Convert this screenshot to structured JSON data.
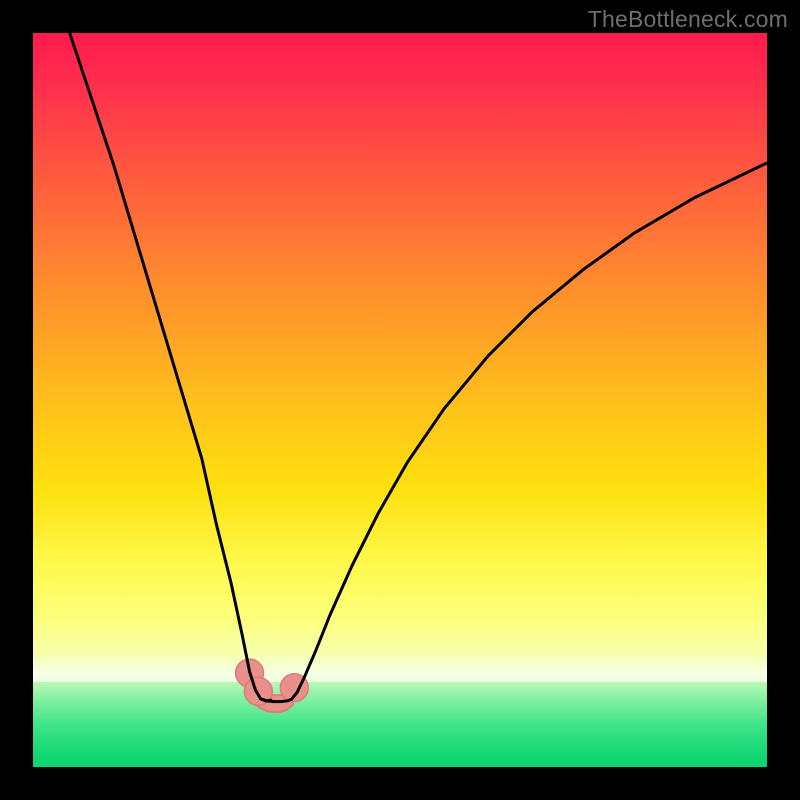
{
  "watermark": "TheBottleneck.com",
  "chart_data": {
    "type": "line",
    "title": "",
    "xlabel": "",
    "ylabel": "",
    "xlim": [
      0,
      100
    ],
    "ylim": [
      0,
      100
    ],
    "gradient_bands": [
      {
        "name": "red-to-yellow",
        "from_y_pct": 100,
        "to_y_pct": 12,
        "colors": [
          "#ff1a4d",
          "#ffb81e",
          "#fff94d"
        ]
      },
      {
        "name": "pale-transition",
        "from_y_pct": 12,
        "to_y_pct": 11,
        "colors": [
          "#f9ffcc",
          "#eefde4"
        ]
      },
      {
        "name": "green",
        "from_y_pct": 11,
        "to_y_pct": 0,
        "colors": [
          "#b9f9b6",
          "#0cd571"
        ]
      }
    ],
    "series": [
      {
        "name": "left_branch",
        "stroke": "#000000",
        "x": [
          5,
          8,
          11,
          14,
          17,
          20,
          23,
          25,
          27,
          28.5,
          29.5,
          30.3,
          31,
          31.7,
          32.4
        ],
        "y": [
          100,
          91,
          82,
          72,
          62,
          52,
          42,
          33,
          25,
          18,
          13,
          10.5,
          9.3,
          9.0,
          9.1
        ]
      },
      {
        "name": "right_branch",
        "stroke": "#000000",
        "x": [
          35.2,
          36,
          37,
          38.5,
          40.5,
          43.5,
          47,
          51,
          56,
          62,
          68,
          75,
          82,
          90,
          100
        ],
        "y": [
          9.2,
          10.2,
          12.3,
          15.8,
          20.8,
          27.5,
          34.5,
          41.5,
          48.8,
          56.0,
          62.0,
          67.8,
          72.8,
          77.5,
          82.3
        ]
      },
      {
        "name": "valley_floor",
        "stroke": "#000000",
        "x": [
          31.0,
          31.9,
          32.8,
          33.7,
          34.6,
          35.2
        ],
        "y": [
          9.3,
          9.0,
          8.9,
          8.9,
          9.0,
          9.2
        ]
      }
    ],
    "markers": [
      {
        "name": "left-pink-marker-upper",
        "x": 29.5,
        "y": 12.8,
        "r": 1.9,
        "color": "#e98f8c"
      },
      {
        "name": "left-pink-marker-lower",
        "x": 30.7,
        "y": 10.3,
        "r": 1.9,
        "color": "#e98f8c"
      },
      {
        "name": "right-pink-marker",
        "x": 35.6,
        "y": 10.8,
        "r": 1.9,
        "color": "#e98f8c"
      }
    ],
    "valley_band": {
      "color": "#e98f8c",
      "outline": "#e07b77",
      "x": [
        30.2,
        31.0,
        31.9,
        32.8,
        33.7,
        34.6,
        35.4
      ],
      "y_top": [
        11.5,
        10.3,
        9.9,
        9.8,
        9.8,
        10.0,
        11.3
      ],
      "y_bottom": [
        8.6,
        8.0,
        7.6,
        7.5,
        7.5,
        7.8,
        8.5
      ]
    }
  }
}
